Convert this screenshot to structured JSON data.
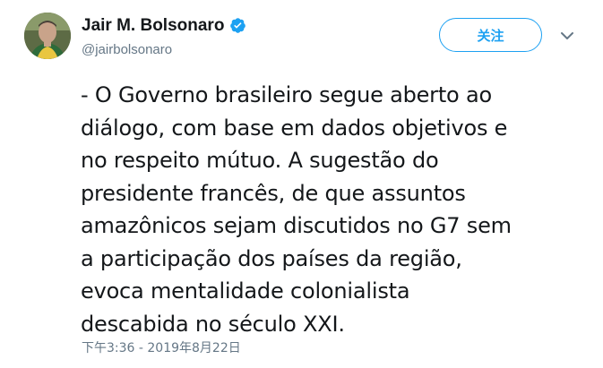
{
  "author": {
    "display_name": "Jair M. Bolsonaro",
    "handle": "@jairbolsonaro",
    "verified": true,
    "avatar_icon": "profile-photo"
  },
  "actions": {
    "follow_label": "关注",
    "menu_icon": "chevron-down-icon"
  },
  "tweet": {
    "text": "- O Governo brasileiro segue aberto ao\ndiálogo, com base em dados objetivos e\nno respeito mútuo. A sugestão do\npresidente francês, de que assuntos\namazônicos sejam discutidos no G7 sem\na participação dos países da região,\nevoca mentalidade colonialista\ndescabida no século XXI.",
    "timestamp": "下午3:36 - 2019年8月22日"
  },
  "colors": {
    "accent": "#1da1f2",
    "text": "#14171a",
    "secondary": "#657786"
  }
}
